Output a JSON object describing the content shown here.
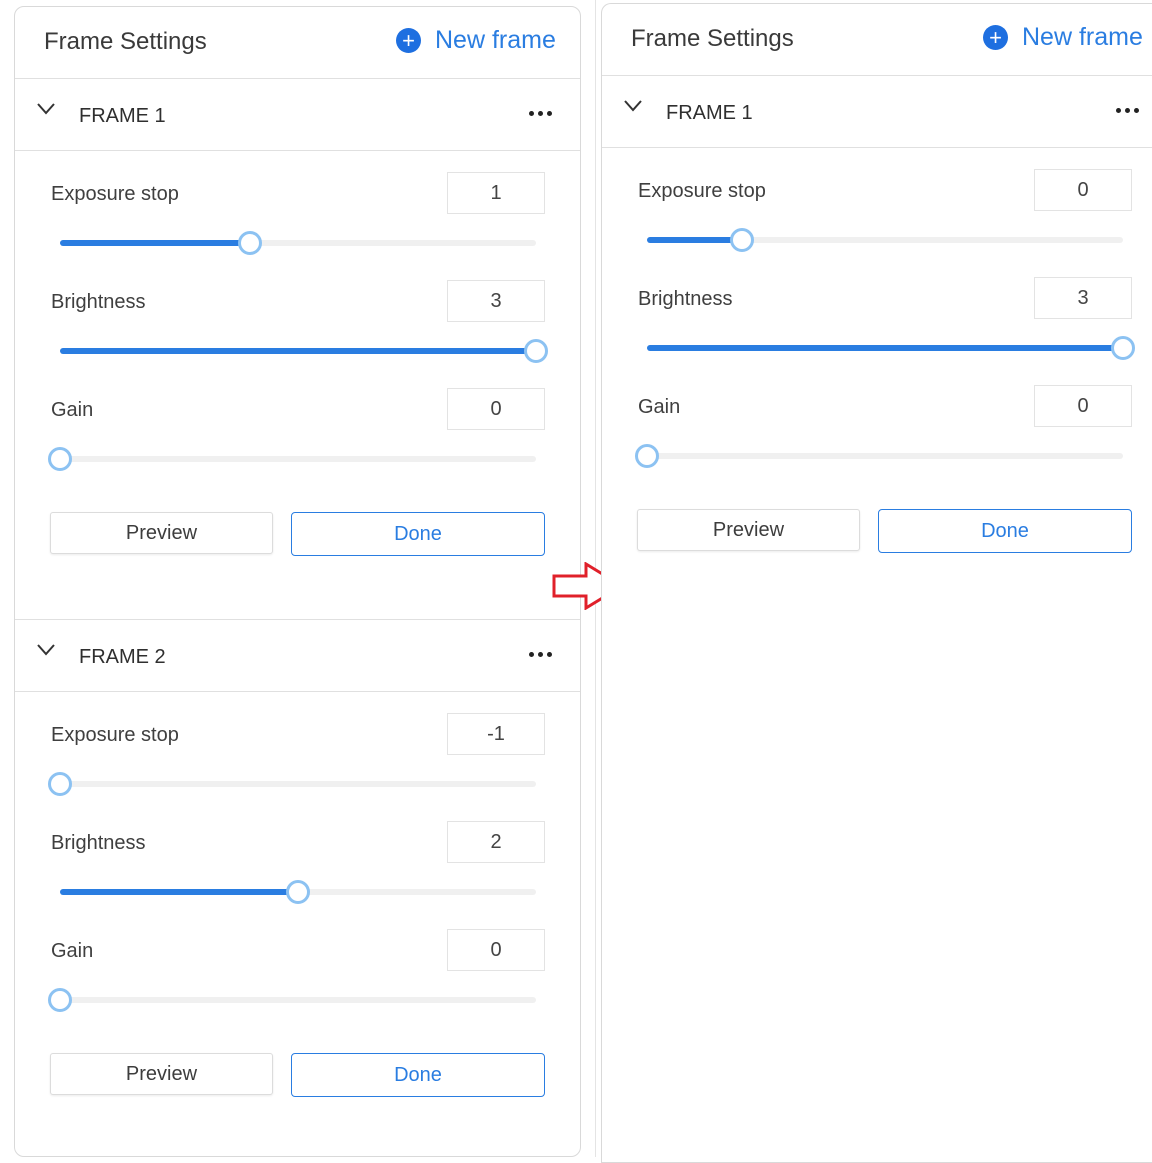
{
  "colors": {
    "accent": "#2a7de1",
    "thumb_border": "#8cc2f2",
    "arrow": "#e0202a"
  },
  "left_panel": {
    "title": "Frame Settings",
    "new_frame_label": "New frame",
    "new_frame_icon": "+",
    "frames": [
      {
        "title": "FRAME 1",
        "settings": [
          {
            "label": "Exposure stop",
            "value": "1",
            "fraction": 0.4
          },
          {
            "label": "Brightness",
            "value": "3",
            "fraction": 1.0
          },
          {
            "label": "Gain",
            "value": "0",
            "fraction": 0.0
          }
        ],
        "preview_label": "Preview",
        "done_label": "Done"
      },
      {
        "title": "FRAME 2",
        "settings": [
          {
            "label": "Exposure stop",
            "value": "-1",
            "fraction": 0.0
          },
          {
            "label": "Brightness",
            "value": "2",
            "fraction": 0.5
          },
          {
            "label": "Gain",
            "value": "0",
            "fraction": 0.0
          }
        ],
        "preview_label": "Preview",
        "done_label": "Done"
      }
    ]
  },
  "right_panel": {
    "title": "Frame Settings",
    "new_frame_label": "New frame",
    "new_frame_icon": "+",
    "frames": [
      {
        "title": "FRAME 1",
        "settings": [
          {
            "label": "Exposure stop",
            "value": "0",
            "fraction": 0.2
          },
          {
            "label": "Brightness",
            "value": "3",
            "fraction": 1.0
          },
          {
            "label": "Gain",
            "value": "0",
            "fraction": 0.0
          }
        ],
        "preview_label": "Preview",
        "done_label": "Done"
      }
    ]
  }
}
